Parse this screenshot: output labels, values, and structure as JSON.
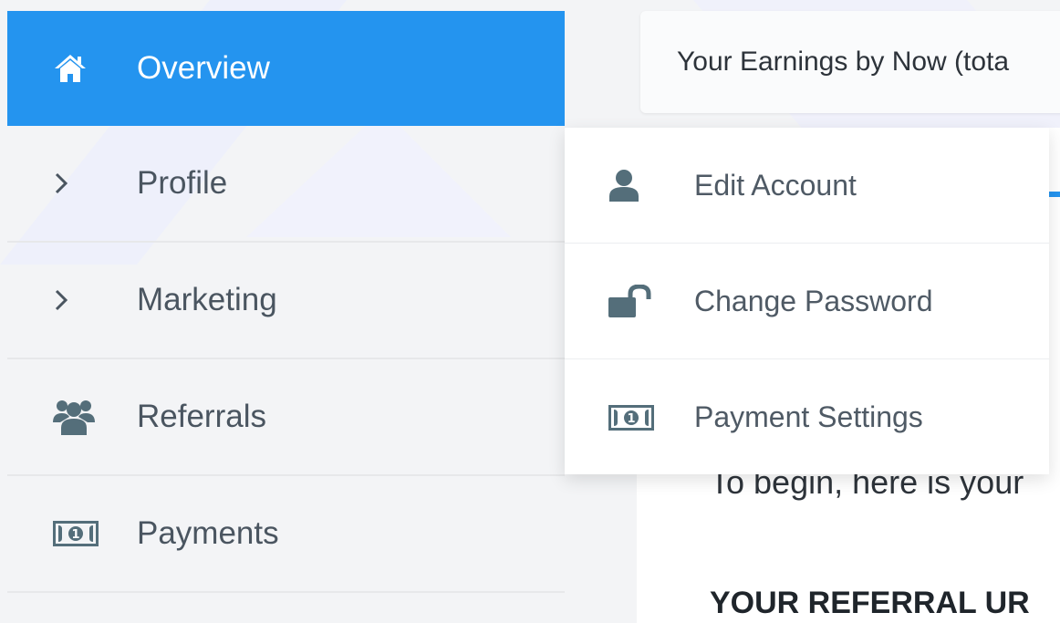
{
  "sidebar": {
    "items": [
      {
        "label": "Overview",
        "icon": "home-icon",
        "active": true
      },
      {
        "label": "Profile",
        "icon": "chevron-right-icon"
      },
      {
        "label": "Marketing",
        "icon": "chevron-right-icon"
      },
      {
        "label": "Referrals",
        "icon": "users-icon"
      },
      {
        "label": "Payments",
        "icon": "money-icon"
      }
    ]
  },
  "submenu": {
    "items": [
      {
        "label": "Edit Account",
        "icon": "user-icon"
      },
      {
        "label": "Change Password",
        "icon": "unlock-icon"
      },
      {
        "label": "Payment Settings",
        "icon": "money-icon"
      }
    ]
  },
  "main": {
    "earnings_label": "Your Earnings by Now (tota",
    "intro_text": "To begin, here is your",
    "referral_heading": "YOUR REFERRAL UR"
  },
  "colors": {
    "accent": "#2494ef",
    "text": "#4a5560",
    "icon": "#546e7a"
  }
}
